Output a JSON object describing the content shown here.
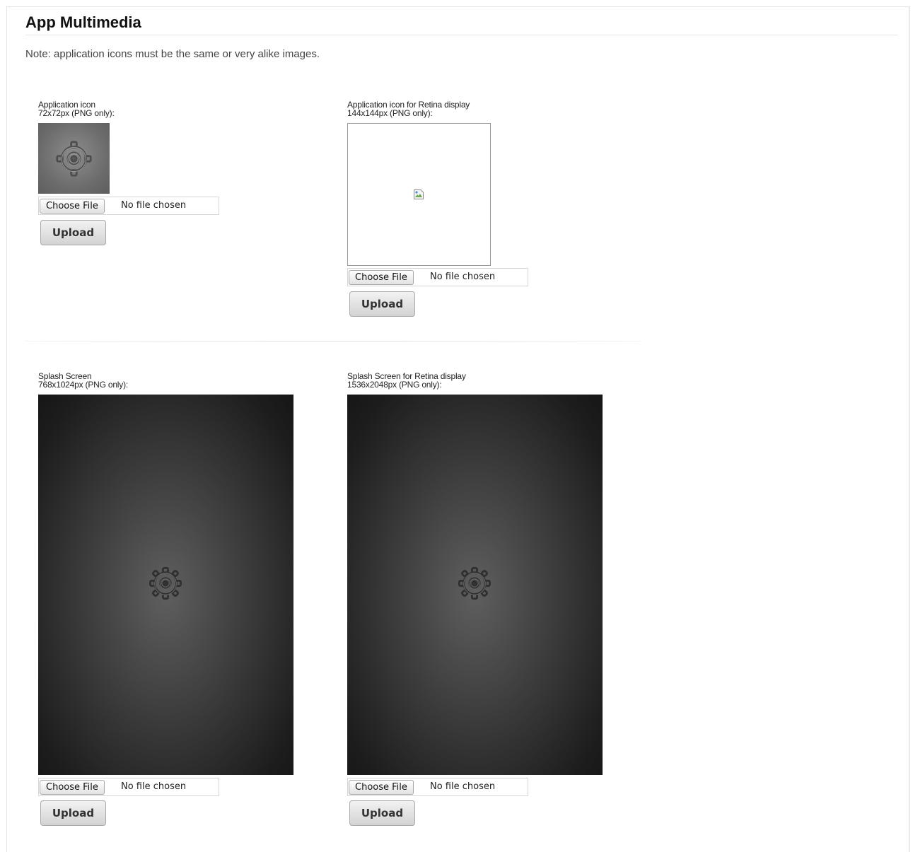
{
  "page": {
    "title": "App Multimedia",
    "note": "Note: application icons must be the same or very alike images."
  },
  "uploads": [
    {
      "label": "Application icon",
      "dimensions": "72x72px (PNG only):",
      "choose_label": "Choose File",
      "file_status": "No file chosen",
      "upload_label": "Upload"
    },
    {
      "label": "Application icon for Retina display",
      "dimensions": "144x144px (PNG only):",
      "choose_label": "Choose File",
      "file_status": "No file chosen",
      "upload_label": "Upload"
    },
    {
      "label": "Splash Screen",
      "dimensions": "768x1024px (PNG only):",
      "choose_label": "Choose File",
      "file_status": "No file chosen",
      "upload_label": "Upload"
    },
    {
      "label": "Splash Screen for Retina display",
      "dimensions": "1536x2048px (PNG only):",
      "choose_label": "Choose File",
      "file_status": "No file chosen",
      "upload_label": "Upload"
    }
  ],
  "icons": {
    "preview": "gear-icon",
    "broken_image": "broken-image-icon"
  },
  "colors": {
    "splash_center": "#5f5f5f",
    "splash_edge": "#161616",
    "icon_background": "#6b6b6b"
  }
}
